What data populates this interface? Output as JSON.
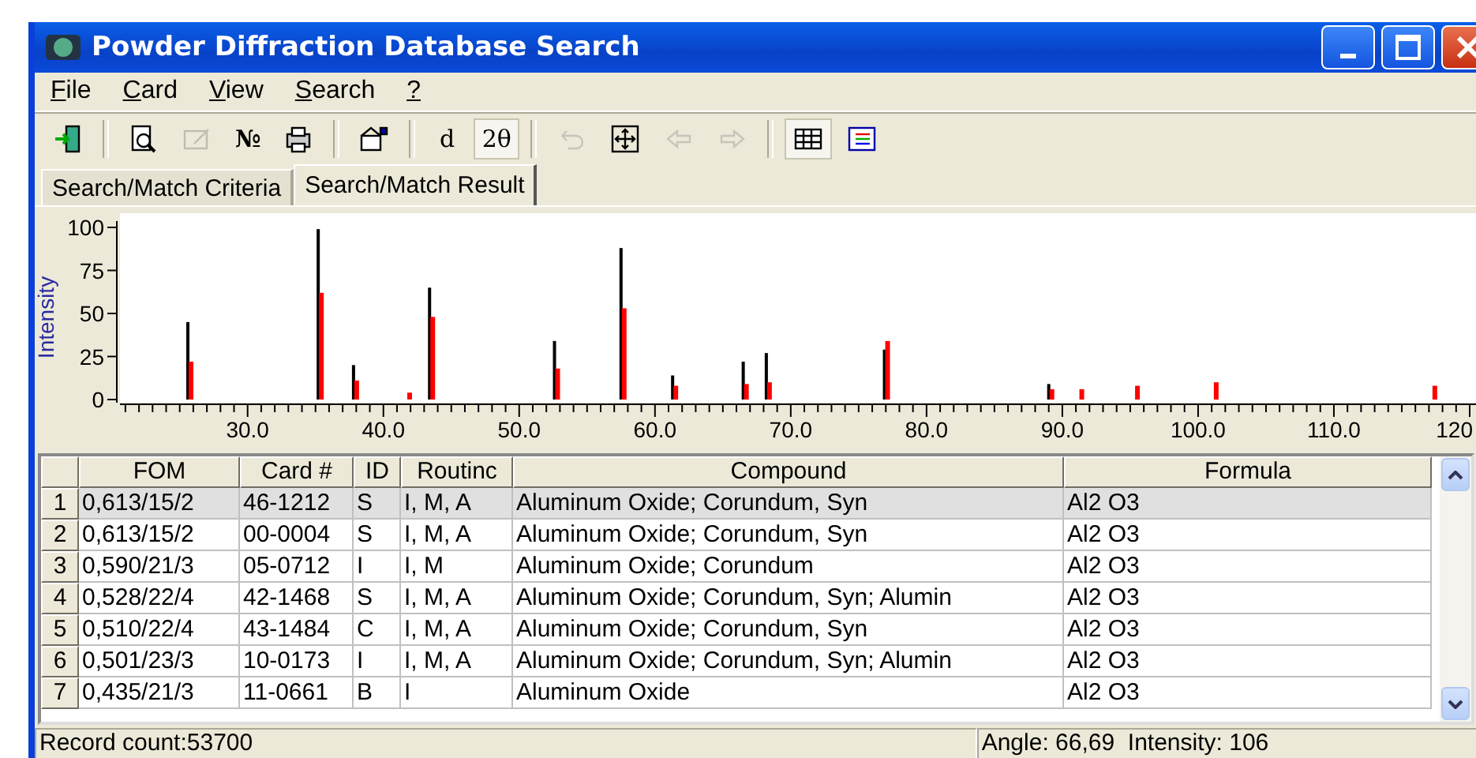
{
  "window": {
    "title": "Powder Diffraction Database Search"
  },
  "menu": [
    {
      "label": "File"
    },
    {
      "label": "Card"
    },
    {
      "label": "View"
    },
    {
      "label": "Search"
    },
    {
      "label": "?"
    }
  ],
  "toolbar": [
    {
      "kind": "icon",
      "disabled": false
    },
    {
      "kind": "sep"
    },
    {
      "kind": "icon",
      "disabled": false
    },
    {
      "kind": "icon",
      "disabled": true
    },
    {
      "kind": "text",
      "label": "№"
    },
    {
      "kind": "icon",
      "disabled": false
    },
    {
      "kind": "sep"
    },
    {
      "kind": "icon",
      "disabled": false
    },
    {
      "kind": "sep"
    },
    {
      "kind": "toggle",
      "label": "d",
      "selected": false
    },
    {
      "kind": "toggle",
      "label": "2θ",
      "selected": true
    },
    {
      "kind": "sep"
    },
    {
      "kind": "icon",
      "disabled": true
    },
    {
      "kind": "icon",
      "disabled": false
    },
    {
      "kind": "icon",
      "disabled": true
    },
    {
      "kind": "icon",
      "disabled": true
    },
    {
      "kind": "sep"
    },
    {
      "kind": "toggle_icon",
      "selected": true
    },
    {
      "kind": "toggle_icon",
      "selected": false
    }
  ],
  "tabs": [
    {
      "label": "Search/Match Criteria",
      "selected": false
    },
    {
      "label": "Search/Match Result",
      "selected": true
    }
  ],
  "chart_data": {
    "type": "bar",
    "ylabel": "Intensity",
    "xlim": [
      20.6,
      120
    ],
    "ylim": [
      0,
      100
    ],
    "xticks": [
      {
        "value": 30,
        "label": "30.0"
      },
      {
        "value": 40,
        "label": "40.0"
      },
      {
        "value": 50,
        "label": "50.0"
      },
      {
        "value": 60,
        "label": "60.0"
      },
      {
        "value": 70,
        "label": "70.0"
      },
      {
        "value": 80,
        "label": "80.0"
      },
      {
        "value": 90,
        "label": "90.0"
      },
      {
        "value": 100,
        "label": "100.0"
      },
      {
        "value": 110,
        "label": "110.0"
      },
      {
        "value": 120,
        "label": "120"
      }
    ],
    "yticks": [
      0,
      25,
      50,
      75,
      100
    ],
    "x": [
      25.6,
      35.2,
      37.8,
      41.7,
      43.4,
      52.6,
      57.5,
      61.3,
      66.5,
      68.2,
      76.9,
      89.0,
      91.2,
      95.3,
      101.1,
      117.2
    ],
    "series": [
      {
        "color": "#000000",
        "values": [
          45,
          99,
          20,
          null,
          65,
          34,
          88,
          14,
          22,
          27,
          29,
          9,
          null,
          null,
          null,
          null
        ]
      },
      {
        "color": "#ff0000",
        "values": [
          22,
          62,
          11,
          4,
          48,
          18,
          53,
          8,
          9,
          10,
          34,
          6,
          6,
          8,
          10,
          8
        ]
      }
    ]
  },
  "table": {
    "columns": [
      "FOM",
      "Card #",
      "ID",
      "Routinc",
      "Compound",
      "Formula"
    ],
    "rows": [
      {
        "num": "1",
        "selected": true,
        "cells": [
          "0,613/15/2",
          "46-1212",
          "S",
          "I, M, A",
          "Aluminum Oxide; Corundum, Syn",
          "Al2 O3"
        ]
      },
      {
        "num": "2",
        "selected": false,
        "cells": [
          "0,613/15/2",
          "00-0004",
          "S",
          "I, M, A",
          "Aluminum Oxide; Corundum, Syn",
          "Al2 O3"
        ]
      },
      {
        "num": "3",
        "selected": false,
        "cells": [
          "0,590/21/3",
          "05-0712",
          "I",
          "I, M",
          "Aluminum Oxide; Corundum",
          "Al2 O3"
        ]
      },
      {
        "num": "4",
        "selected": false,
        "cells": [
          "0,528/22/4",
          "42-1468",
          "S",
          "I, M, A",
          "Aluminum Oxide; Corundum, Syn; Alumin",
          "Al2 O3"
        ]
      },
      {
        "num": "5",
        "selected": false,
        "cells": [
          "0,510/22/4",
          "43-1484",
          "C",
          "I, M, A",
          "Aluminum Oxide; Corundum, Syn",
          "Al2 O3"
        ]
      },
      {
        "num": "6",
        "selected": false,
        "cells": [
          "0,501/23/3",
          "10-0173",
          "I",
          "I, M, A",
          "Aluminum Oxide; Corundum, Syn; Alumin",
          "Al2 O3"
        ]
      },
      {
        "num": "7",
        "selected": false,
        "cells": [
          "0,435/21/3",
          "11-0661",
          "B",
          "I",
          "Aluminum Oxide",
          "Al2 O3"
        ]
      }
    ]
  },
  "status_bar": {
    "left": "Record count:53700",
    "right": "Angle: 66,69  Intensity: 106"
  }
}
